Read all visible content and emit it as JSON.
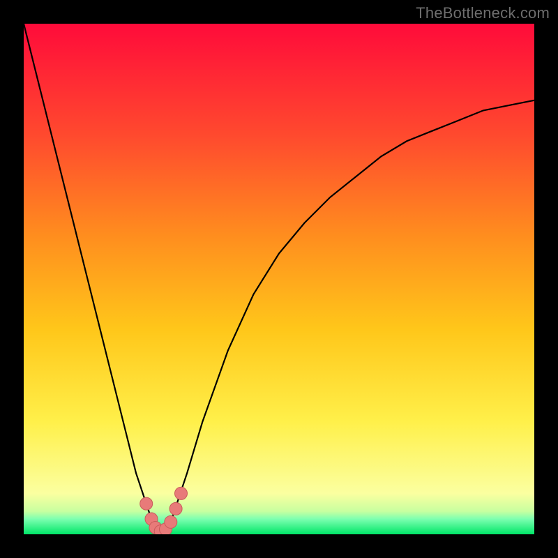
{
  "watermark": "TheBottleneck.com",
  "colors": {
    "frame": "#000000",
    "grad_top": "#ff0b3a",
    "grad_mid1": "#ff4a2e",
    "grad_mid2": "#ff8f1e",
    "grad_mid3": "#ffc71a",
    "grad_mid4": "#fff04a",
    "grad_low": "#fbffa0",
    "grad_band": "#c8ffa0",
    "grad_green": "#00e668",
    "curve": "#000000",
    "dot_fill": "#e87a79",
    "dot_stroke": "#c95b5b"
  },
  "chart_data": {
    "type": "line",
    "title": "",
    "xlabel": "",
    "ylabel": "",
    "xlim": [
      0,
      100
    ],
    "ylim": [
      0,
      100
    ],
    "series": [
      {
        "name": "bottleneck-curve",
        "x": [
          0,
          5,
          10,
          15,
          20,
          22,
          24,
          25,
          26,
          27,
          28,
          29,
          30,
          32,
          35,
          40,
          45,
          50,
          55,
          60,
          65,
          70,
          75,
          80,
          85,
          90,
          95,
          100
        ],
        "y": [
          100,
          80,
          60,
          40,
          20,
          12,
          6,
          3,
          1,
          0.5,
          1,
          3,
          6,
          12,
          22,
          36,
          47,
          55,
          61,
          66,
          70,
          74,
          77,
          79,
          81,
          83,
          84,
          85
        ]
      }
    ],
    "markers": {
      "name": "highlight-dots",
      "x": [
        24.0,
        25.0,
        25.8,
        26.8,
        27.8,
        28.8,
        29.8,
        30.8
      ],
      "y": [
        6.0,
        3.0,
        1.3,
        0.6,
        1.0,
        2.4,
        5.0,
        8.0
      ]
    },
    "gradient_bands_y": [
      0,
      1.5,
      3.0,
      5.0,
      82,
      100
    ],
    "minimum_x": 27
  }
}
